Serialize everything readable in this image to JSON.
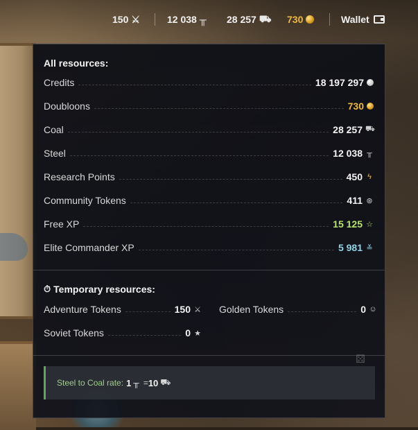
{
  "topbar": {
    "free_xp_like": {
      "value": "150",
      "icon": "crossed-swords-icon"
    },
    "steel": {
      "value": "12 038",
      "icon": "steel-icon"
    },
    "coal": {
      "value": "28 257",
      "icon": "coal-cart-icon"
    },
    "doubloons": {
      "value": "730",
      "icon": "gold-coin-icon",
      "color": "#f0b93a"
    },
    "wallet_label": "Wallet"
  },
  "panel": {
    "all_title": "All resources:",
    "resources": [
      {
        "label": "Credits",
        "value": "18 197 297",
        "icon": "credit-coin-icon"
      },
      {
        "label": "Doubloons",
        "value": "730",
        "icon": "gold-coin-icon",
        "color": "#f0b93a"
      },
      {
        "label": "Coal",
        "value": "28 257",
        "icon": "coal-cart-icon"
      },
      {
        "label": "Steel",
        "value": "12 038",
        "icon": "steel-icon"
      },
      {
        "label": "Research Points",
        "value": "450",
        "icon": "research-bolt-icon"
      },
      {
        "label": "Community Tokens",
        "value": "411",
        "icon": "community-token-icon"
      },
      {
        "label": "Free XP",
        "value": "15 125",
        "icon": "star-icon",
        "color": "#b6e46e"
      },
      {
        "label": "Elite Commander XP",
        "value": "5 981",
        "icon": "commander-xp-icon",
        "color": "#8fd6e8"
      }
    ],
    "temp_title": "Temporary resources:",
    "temp_resources": [
      {
        "label": "Adventure Tokens",
        "value": "150",
        "icon": "crossed-swords-icon"
      },
      {
        "label": "Golden Tokens",
        "value": "0",
        "icon": "golden-token-icon"
      },
      {
        "label": "Soviet Tokens",
        "value": "0",
        "icon": "soviet-star-icon"
      }
    ],
    "rate": {
      "label": "Steel to Coal rate:",
      "steel": "1",
      "coal": "10",
      "eq": "="
    }
  }
}
